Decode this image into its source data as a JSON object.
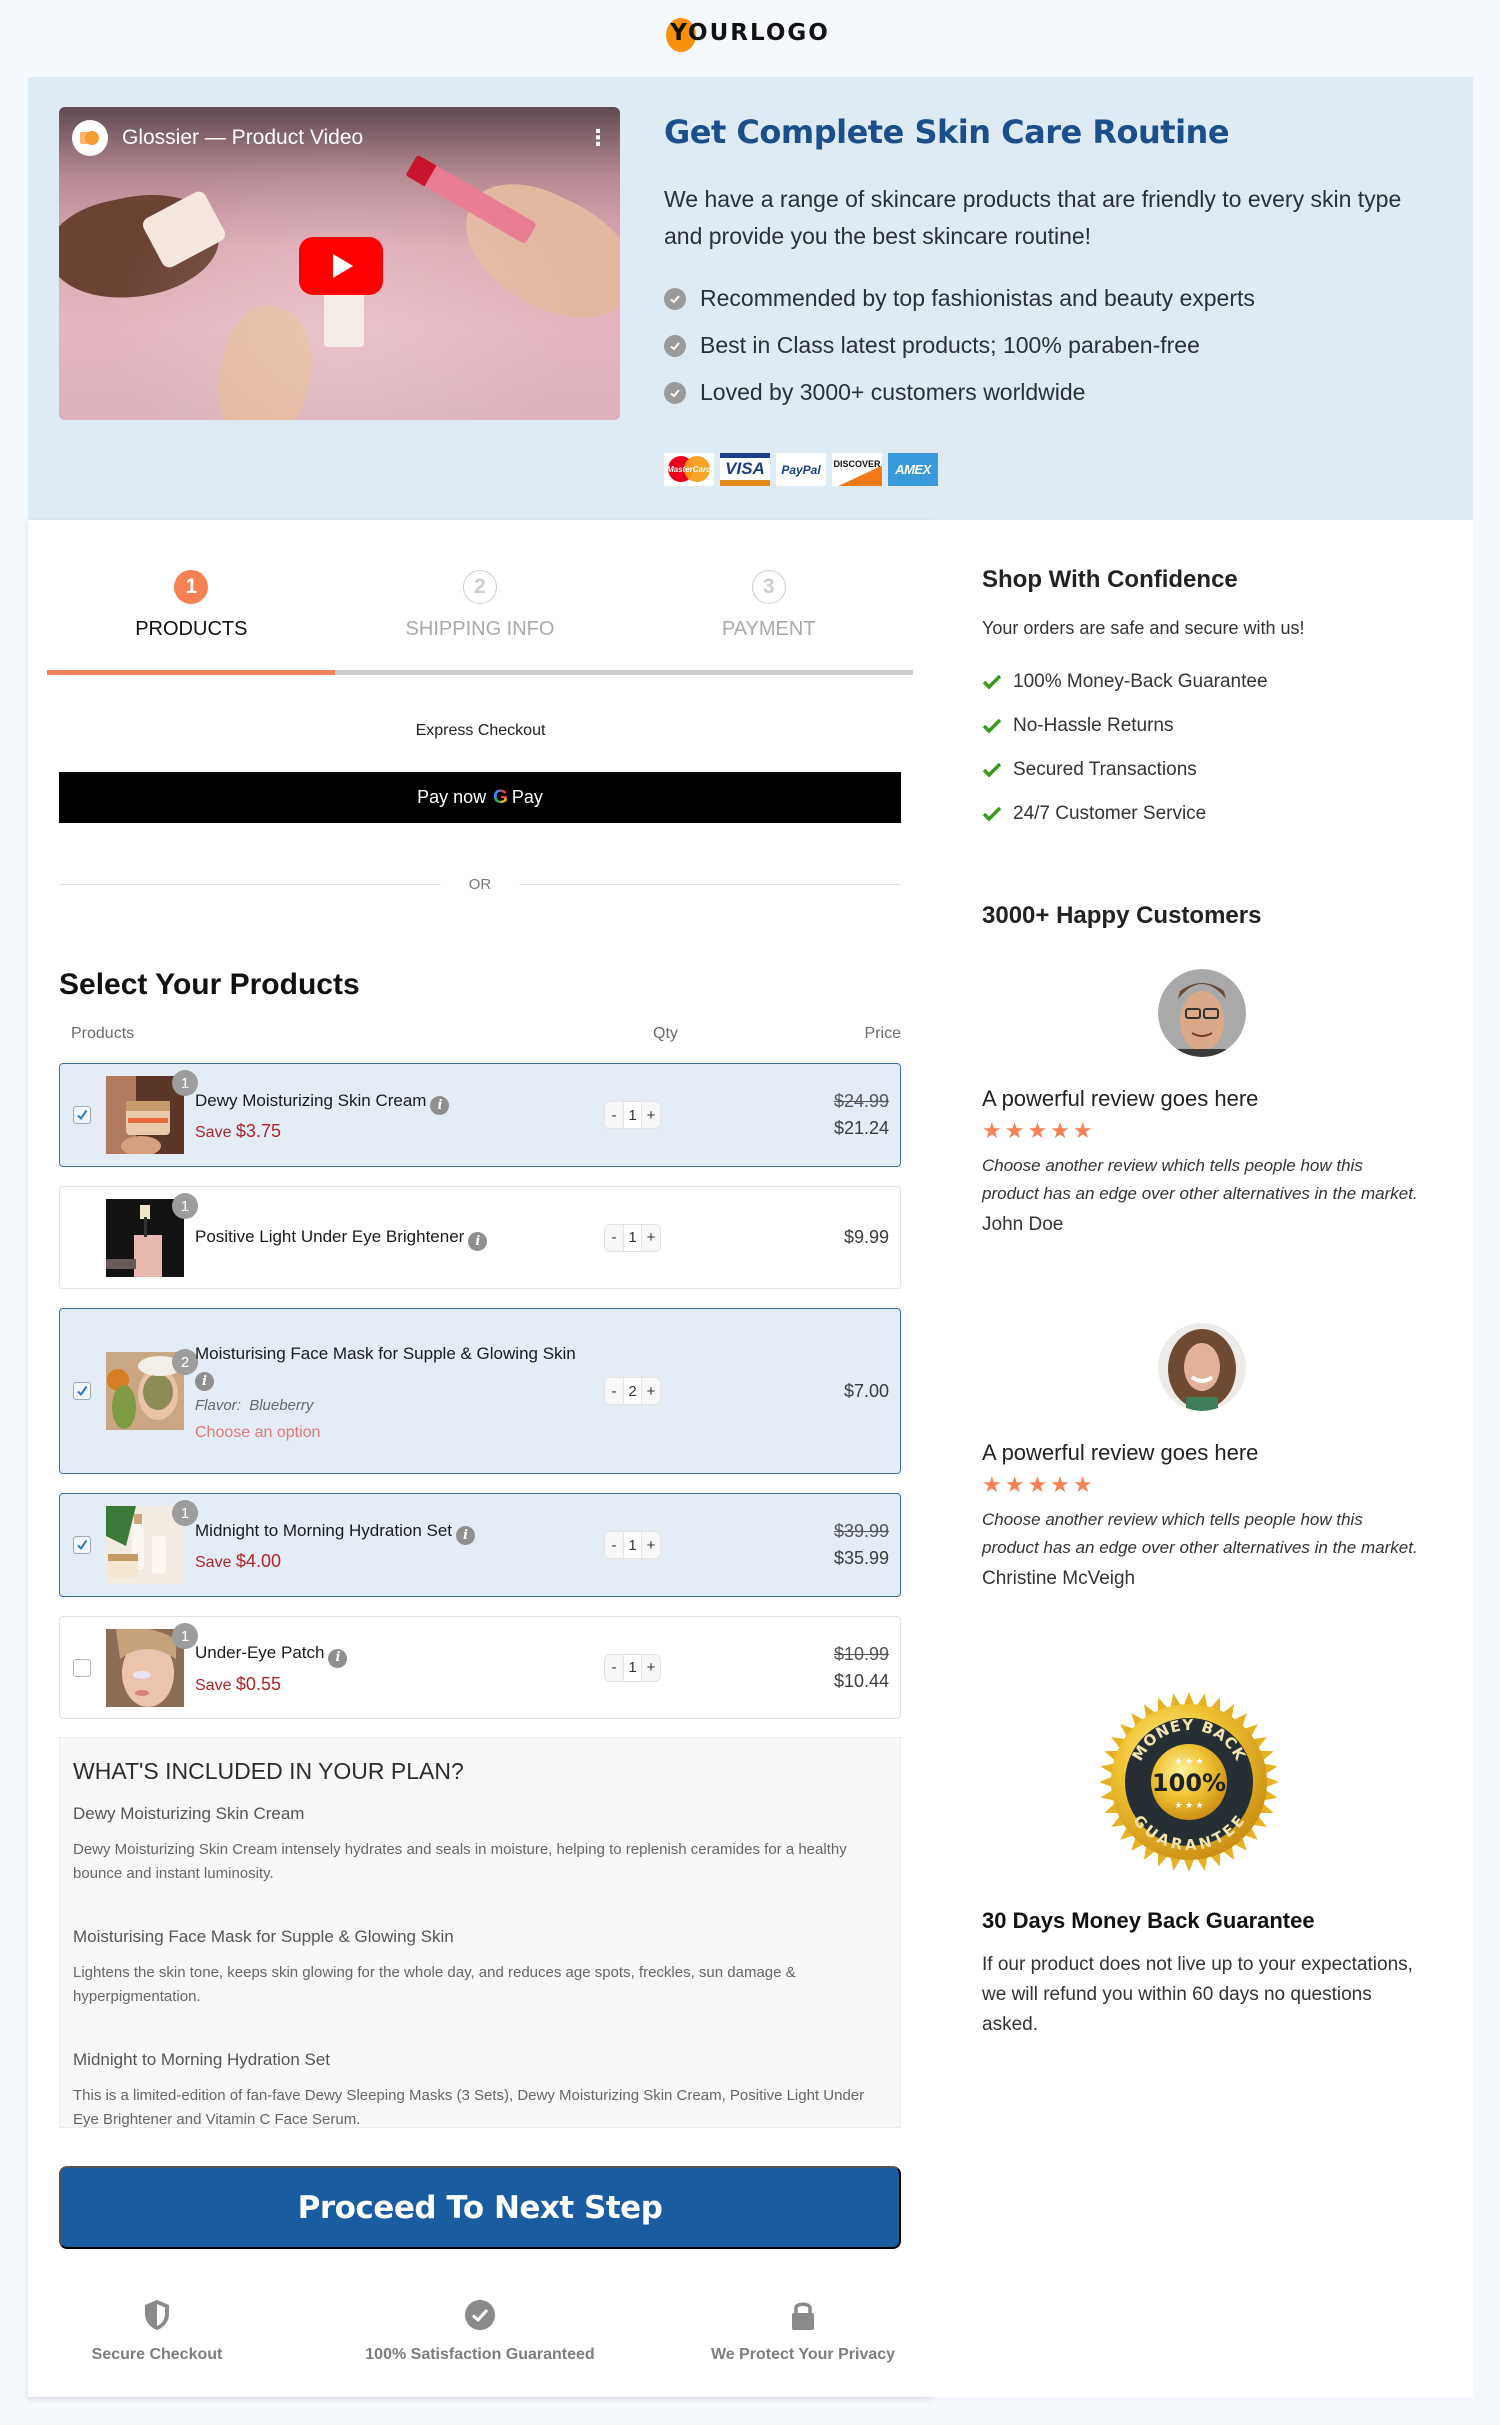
{
  "logo": {
    "text": "YOURLOGO",
    "accent": "#f7900a"
  },
  "hero": {
    "video": {
      "title": "Glossier — Product Video",
      "menu_icon": "vertical-dots-icon",
      "play_icon": "youtube-play-icon"
    },
    "title": "Get Complete Skin Care Routine",
    "description": "We have a range of skincare products that are friendly to every skin type and provide you the best skincare routine!",
    "bullets": [
      "Recommended by top fashionistas and beauty experts",
      "Best in Class latest products; 100% paraben-free",
      "Loved by 3000+ customers worldwide"
    ],
    "payment_cards": [
      {
        "name": "mastercard",
        "label": "MasterCard"
      },
      {
        "name": "visa",
        "label": "VISA"
      },
      {
        "name": "paypal",
        "label": "PayPal"
      },
      {
        "name": "discover",
        "label": "DISCOVER"
      },
      {
        "name": "amex",
        "label": "AMEX"
      }
    ]
  },
  "steps": [
    {
      "number": "1",
      "label": "PRODUCTS",
      "active": true
    },
    {
      "number": "2",
      "label": "SHIPPING INFO",
      "active": false
    },
    {
      "number": "3",
      "label": "PAYMENT",
      "active": false
    }
  ],
  "progress_fraction": 0.333,
  "express": {
    "label": "Express Checkout",
    "gpay_prefix": "Pay now",
    "gpay_g": "G",
    "gpay_suffix": "Pay",
    "or": "OR"
  },
  "products_section": {
    "title": "Select Your Products",
    "headers": {
      "product": "Products",
      "qty": "Qty",
      "price": "Price"
    },
    "items": [
      {
        "name": "Dewy Moisturizing Skin Cream",
        "badge": "1",
        "checked": true,
        "show_checkbox": true,
        "save_label": "Save",
        "save_amount": "$3.75",
        "qty": "1",
        "price_original": "$24.99",
        "price": "$21.24"
      },
      {
        "name": "Positive Light Under Eye Brightener",
        "badge": "1",
        "checked": false,
        "show_checkbox": false,
        "qty": "1",
        "price": "$9.99"
      },
      {
        "name": "Moisturising Face Mask for Supple & Glowing Skin",
        "badge": "2",
        "checked": true,
        "show_checkbox": true,
        "flavor_label": "Flavor",
        "flavor_value": "Blueberry",
        "option_prompt": "Choose an option",
        "qty": "2",
        "price": "$7.00"
      },
      {
        "name": "Midnight to Morning Hydration Set",
        "badge": "1",
        "checked": true,
        "show_checkbox": true,
        "save_label": "Save",
        "save_amount": "$4.00",
        "qty": "1",
        "price_original": "$39.99",
        "price": "$35.99"
      },
      {
        "name": "Under-Eye Patch",
        "badge": "1",
        "checked": false,
        "show_checkbox": true,
        "save_label": "Save",
        "save_amount": "$0.55",
        "qty": "1",
        "price_original": "$10.99",
        "price": "$10.44"
      }
    ],
    "qty_minus": "-",
    "qty_plus": "+"
  },
  "plan": {
    "title": "WHAT'S INCLUDED IN YOUR PLAN?",
    "items": [
      {
        "title": "Dewy Moisturizing Skin Cream",
        "description": "Dewy Moisturizing Skin Cream intensely hydrates and seals in moisture, helping to replenish ceramides for a healthy bounce and instant luminosity."
      },
      {
        "title": "Moisturising Face Mask for Supple & Glowing Skin",
        "description": "Lightens the skin tone, keeps skin glowing for the whole day, and reduces age spots, freckles, sun damage & hyperpigmentation."
      },
      {
        "title": "Midnight to Morning Hydration Set",
        "description": "This is a limited-edition of fan-fave Dewy Sleeping Masks (3 Sets), Dewy Moisturizing Skin Cream, Positive Light Under Eye Brightener and Vitamin C Face Serum."
      }
    ]
  },
  "proceed_label": "Proceed To Next Step",
  "trust_badges": [
    {
      "icon": "shield-icon",
      "label": "Secure Checkout"
    },
    {
      "icon": "check-circle-icon",
      "label": "100% Satisfaction Guaranteed"
    },
    {
      "icon": "lock-icon",
      "label": "We Protect Your Privacy"
    }
  ],
  "sidebar": {
    "confidence_title": "Shop With Confidence",
    "confidence_subtitle": "Your orders are safe and secure with us!",
    "confidence_items": [
      "100% Money-Back Guarantee",
      "No-Hassle Returns",
      "Secured Transactions",
      "24/7 Customer Service"
    ],
    "happy_title": "3000+ Happy Customers",
    "reviews": [
      {
        "title": "A powerful review goes here",
        "rating": 5,
        "stars": "★★★★★",
        "body": "Choose another review which tells people how this product has an edge over other alternatives in the market.",
        "author": "John Doe"
      },
      {
        "title": "A powerful review goes here",
        "rating": 5,
        "stars": "★★★★★",
        "body": "Choose another review which tells people how this product has an edge over other alternatives in the market.",
        "author": "Christine McVeigh"
      }
    ],
    "seal": {
      "top": "MONEY BACK",
      "center": "100%",
      "bottom": "GUARANTEE"
    },
    "guarantee_title": "30 Days Money Back Guarantee",
    "guarantee_text": "If our product does not live up to your expectations, we will refund you within 60 days no questions asked."
  },
  "colors": {
    "accent_orange": "#f68154",
    "brand_blue": "#1a5ca0",
    "title_blue": "#1a4f8b",
    "save_red": "#b1242a",
    "check_green": "#3b9a1e",
    "hero_bg": "#deeaf4",
    "selected_row_bg": "#e4edf6"
  }
}
